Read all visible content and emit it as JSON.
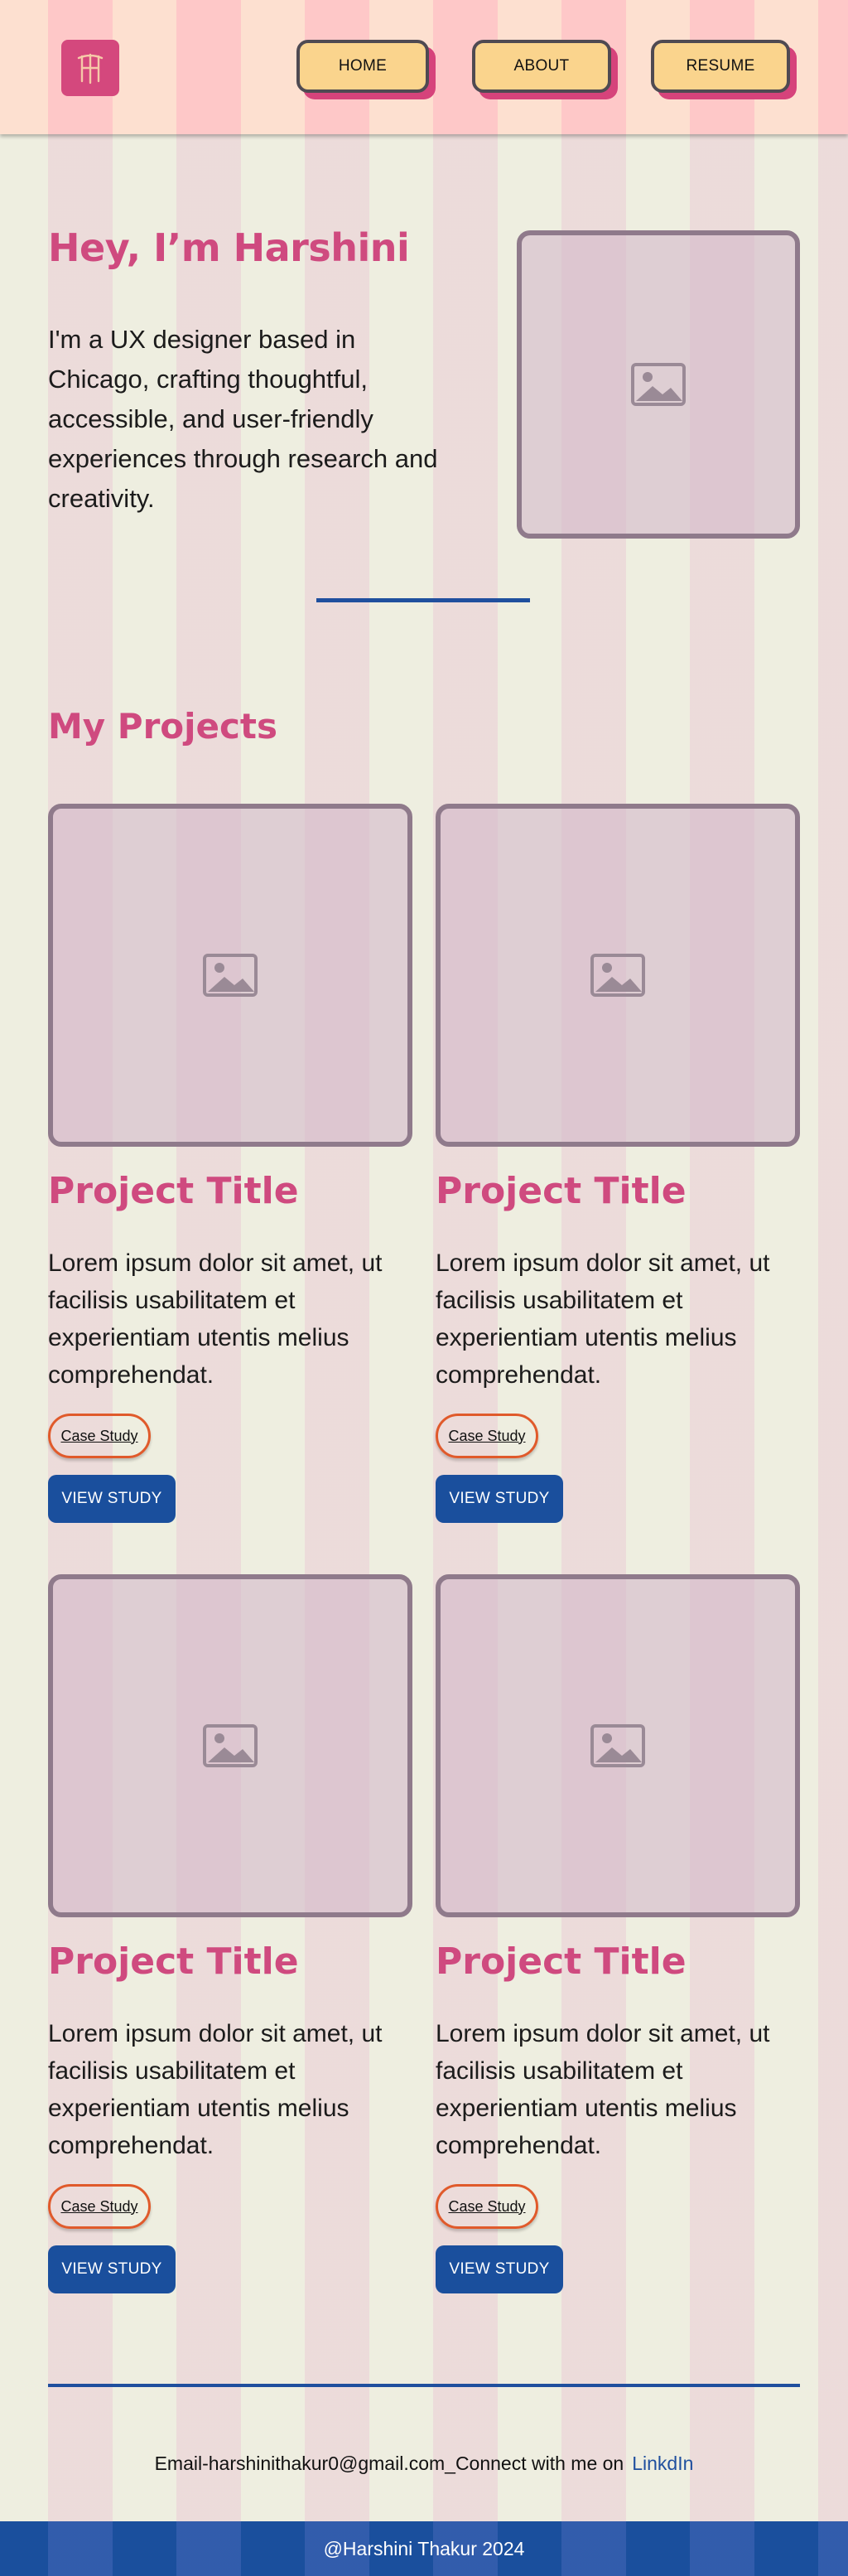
{
  "colors": {
    "accent_pink": "#cf4a7f",
    "primary_blue": "#1a4f9d",
    "nav_button_fill": "#fad48d",
    "case_study_border": "#e05a2b",
    "page_background": "#eeeee0"
  },
  "header": {
    "logo_icon": "hs-monogram-logo",
    "nav": {
      "home_label": "HOME",
      "about_label": "ABOUT",
      "resume_label": "RESUME"
    }
  },
  "hero": {
    "title": "Hey, I’m Harshini",
    "description": "I'm a UX designer based in Chicago, crafting thoughtful, accessible, and user-friendly experiences through research and creativity.",
    "image_icon": "image-placeholder-icon"
  },
  "projects": {
    "section_title": "My Projects",
    "items": [
      {
        "title": "Project Title",
        "description": "Lorem ipsum dolor sit amet, ut facilisis usabilitatem et experientiam utentis melius comprehendat.",
        "case_study_label": "Case Study",
        "view_label": "VIEW STUDY"
      },
      {
        "title": "Project Title",
        "description": "Lorem ipsum dolor sit amet, ut facilisis usabilitatem et experientiam utentis melius comprehendat.",
        "case_study_label": "Case Study",
        "view_label": "VIEW STUDY"
      },
      {
        "title": "Project Title",
        "description": "Lorem ipsum dolor sit amet, ut facilisis usabilitatem et experientiam utentis melius comprehendat.",
        "case_study_label": "Case Study",
        "view_label": "VIEW STUDY"
      },
      {
        "title": "Project Title",
        "description": "Lorem ipsum dolor sit amet, ut facilisis usabilitatem et experientiam utentis melius comprehendat.",
        "case_study_label": "Case Study",
        "view_label": "VIEW STUDY"
      }
    ]
  },
  "footer": {
    "contact_text": "Email-harshinithakur0@gmail.com_Connect with me on",
    "linkedin_label": "LinkdIn",
    "copyright": "@Harshini Thakur 2024"
  }
}
